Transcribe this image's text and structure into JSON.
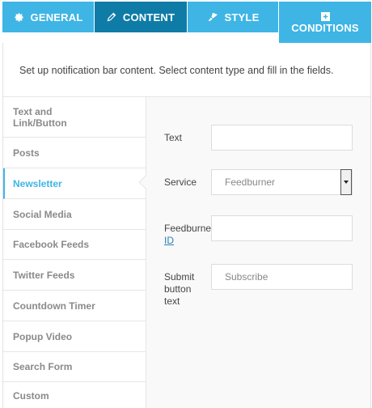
{
  "tabs": [
    {
      "label": "GENERAL",
      "icon": "gear-icon",
      "active": false
    },
    {
      "label": "CONTENT",
      "icon": "pencil-icon",
      "active": true
    },
    {
      "label": "STYLE",
      "icon": "brush-icon",
      "active": false
    },
    {
      "label": "CONDITIONS",
      "icon": "conditions-icon",
      "active": false
    }
  ],
  "intro": "Set up notification bar content. Select content type and fill in the fields.",
  "sidebar": {
    "items": [
      {
        "label": "Text and Link/Button"
      },
      {
        "label": "Posts"
      },
      {
        "label": "Newsletter",
        "active": true
      },
      {
        "label": "Social Media"
      },
      {
        "label": "Facebook Feeds"
      },
      {
        "label": "Twitter Feeds"
      },
      {
        "label": "Countdown Timer"
      },
      {
        "label": "Popup Video"
      },
      {
        "label": "Search Form"
      },
      {
        "label": "Custom"
      }
    ]
  },
  "form": {
    "text_label": "Text",
    "text_value": "",
    "service_label": "Service",
    "service_value": "Feedburner",
    "feedburner_label": "Feedburne",
    "feedburner_link": "ID",
    "feedburner_value": "",
    "submit_label_1": "Submit",
    "submit_label_2": "button",
    "submit_label_3": "text",
    "submit_placeholder": "Subscribe"
  },
  "colors": {
    "tab": "#3eb5e5",
    "tab_active": "#0f7ca7",
    "accent": "#3eb5e5"
  }
}
